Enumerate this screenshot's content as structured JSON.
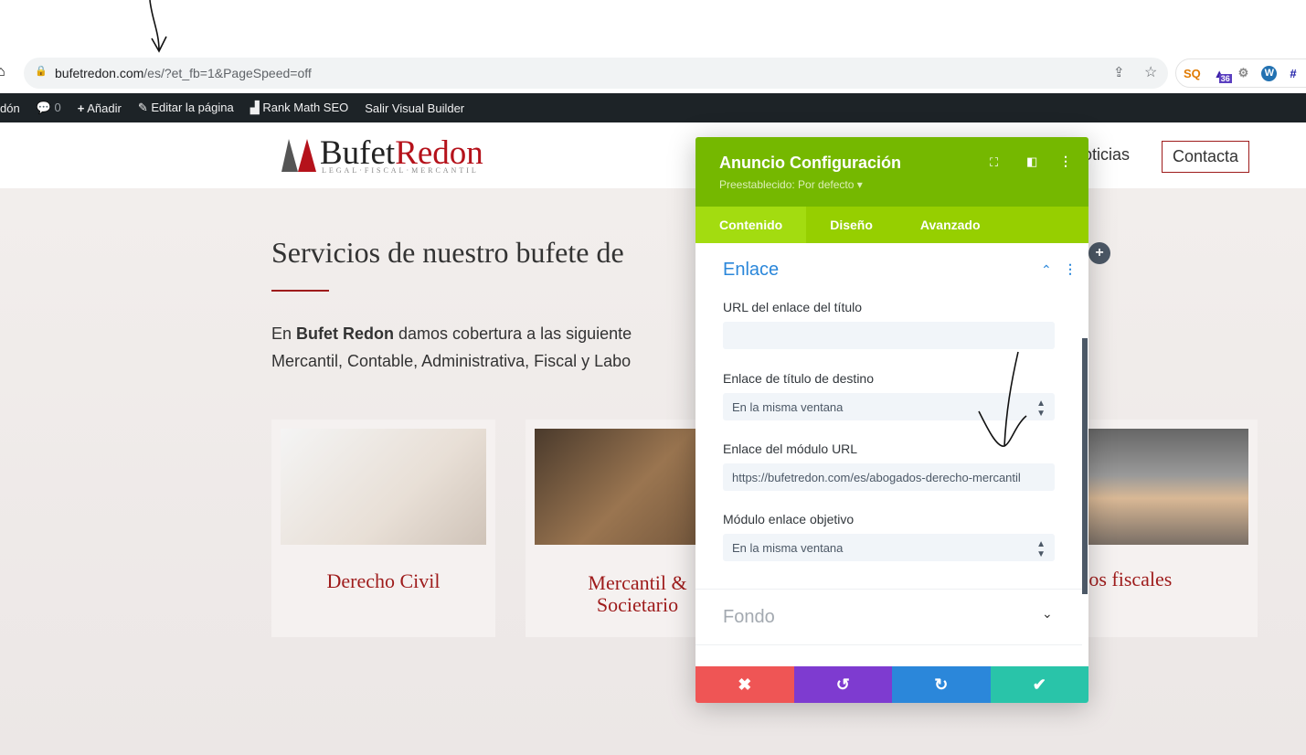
{
  "browser": {
    "url_host": "bufetredon.com",
    "url_path": "/es/?et_fb=1&PageSpeed=off",
    "extension_badge": "36",
    "ext_sq": "SQ",
    "ext_hash": "#"
  },
  "adminbar": {
    "site": "dón",
    "comments": "0",
    "add": "Añadir",
    "edit": "Editar la página",
    "rankmath": "Rank Math SEO",
    "exit": "Salir Visual Builder"
  },
  "header": {
    "logo_a": "Bufet",
    "logo_b": "Redon",
    "logo_tagline": "LEGAL·FISCAL·MERCANTIL",
    "nav_partial": "oticias",
    "contact": "Contacta"
  },
  "main": {
    "title": "Servicios de nuestro bufete de",
    "intro_strong": "Bufet Redon",
    "intro_pre": "En ",
    "intro_rest": " damos cobertura a las siguiente",
    "intro_line2": "Mercantil, Contable, Administrativa, Fiscal y Labo",
    "cards": [
      {
        "title": "Derecho Civil"
      },
      {
        "title": "Mercantil &",
        "title2": "Societario"
      },
      {
        "title": "rvicios fiscales"
      }
    ]
  },
  "panel": {
    "title": "Anuncio Configuración",
    "preset": "Preestablecido: Por defecto ▾",
    "tabs": [
      "Contenido",
      "Diseño",
      "Avanzado"
    ],
    "section": "Enlace",
    "fields": [
      {
        "label": "URL del enlace del título",
        "value": ""
      },
      {
        "label": "Enlace de título de destino",
        "value": "En la misma ventana"
      },
      {
        "label": "Enlace del módulo URL",
        "value": "https://bufetredon.com/es/abogados-derecho-mercantil"
      },
      {
        "label": "Módulo enlace objetivo",
        "value": "En la misma ventana"
      }
    ],
    "section2": "Fondo",
    "colors": {
      "cancel": "#ef5555",
      "undo": "#7e3bd0",
      "redo": "#2b87da",
      "save": "#29c4a9"
    }
  }
}
